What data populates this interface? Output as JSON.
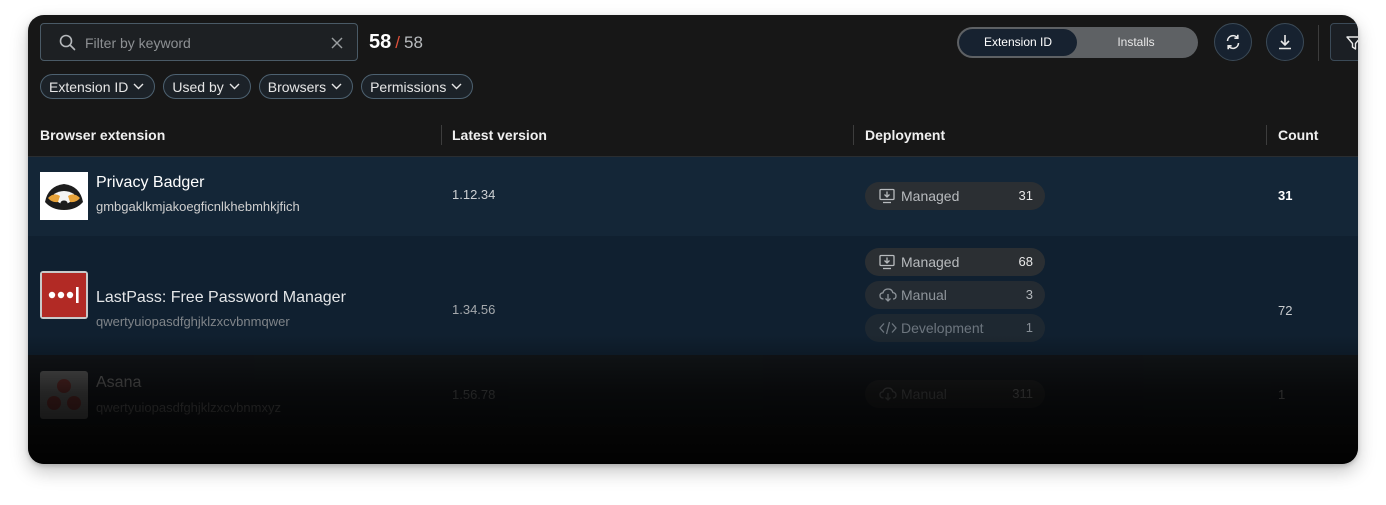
{
  "search": {
    "placeholder": "Filter by keyword",
    "value": ""
  },
  "counts": {
    "shown": "58",
    "separator": "/",
    "total": "58"
  },
  "view_toggle": {
    "options": [
      "Extension ID",
      "Installs"
    ],
    "selected": "Extension ID"
  },
  "filters": [
    "Extension ID",
    "Used by",
    "Browsers",
    "Permissions"
  ],
  "table": {
    "headers": [
      "Browser extension",
      "Latest version",
      "Deployment",
      "Count"
    ],
    "rows": [
      {
        "name": "Privacy Badger",
        "id": "gmbgaklkmjakoegficnlkhebmhkjfich",
        "version": "1.12.34",
        "deployments": [
          {
            "type": "Managed",
            "count": "31",
            "icon": "managed-icon"
          }
        ],
        "count": "31"
      },
      {
        "name": "LastPass: Free Password Manager",
        "id": "qwertyuiopasdfghjklzxcvbnmqwer",
        "version": "1.34.56",
        "deployments": [
          {
            "type": "Managed",
            "count": "68",
            "icon": "managed-icon"
          },
          {
            "type": "Manual",
            "count": "3",
            "icon": "cloud-download-icon"
          },
          {
            "type": "Development",
            "count": "1",
            "icon": "code-icon"
          }
        ],
        "count": "72"
      },
      {
        "name": "Asana",
        "id": "qwertyuiopasdfghjklzxcvbnmxyz",
        "version": "1.56.78",
        "deployments": [
          {
            "type": "Manual",
            "count": "311",
            "icon": "cloud-download-icon"
          }
        ],
        "count": "1"
      }
    ]
  },
  "colors": {
    "background": "#171717",
    "row_selected": "#142637",
    "accent_separator": "#e0513c",
    "pill": "#2b2f33",
    "toggle_active": "#172230"
  }
}
